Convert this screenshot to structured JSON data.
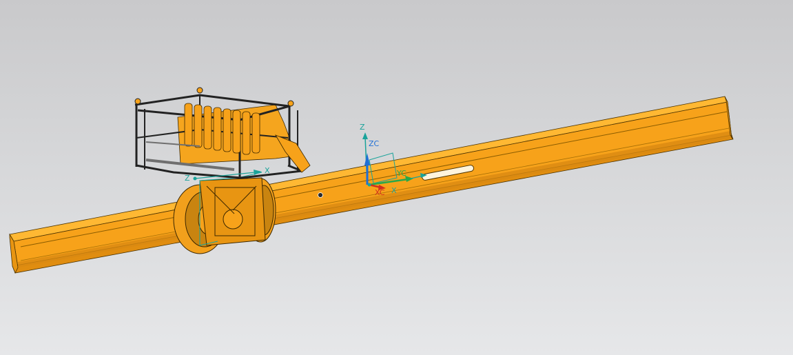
{
  "viewport": {
    "name": "graphics-window",
    "background_top": "#c9c9cb",
    "background_bottom": "#e6e7e9",
    "model_color": "#f7a21a",
    "model_edge_color": "#4a3200"
  },
  "wcs_triad": {
    "z_label": "Z",
    "zc_label": "ZC",
    "yc_label": "YC",
    "xc_label": "XC",
    "x_label": "X",
    "colors": {
      "z": "#1f6fd6",
      "y": "#2aa84a",
      "x": "#d22f1e",
      "handle": "#1aa39a"
    }
  },
  "local_csys": {
    "z_label": "Z",
    "x_label": "X"
  }
}
